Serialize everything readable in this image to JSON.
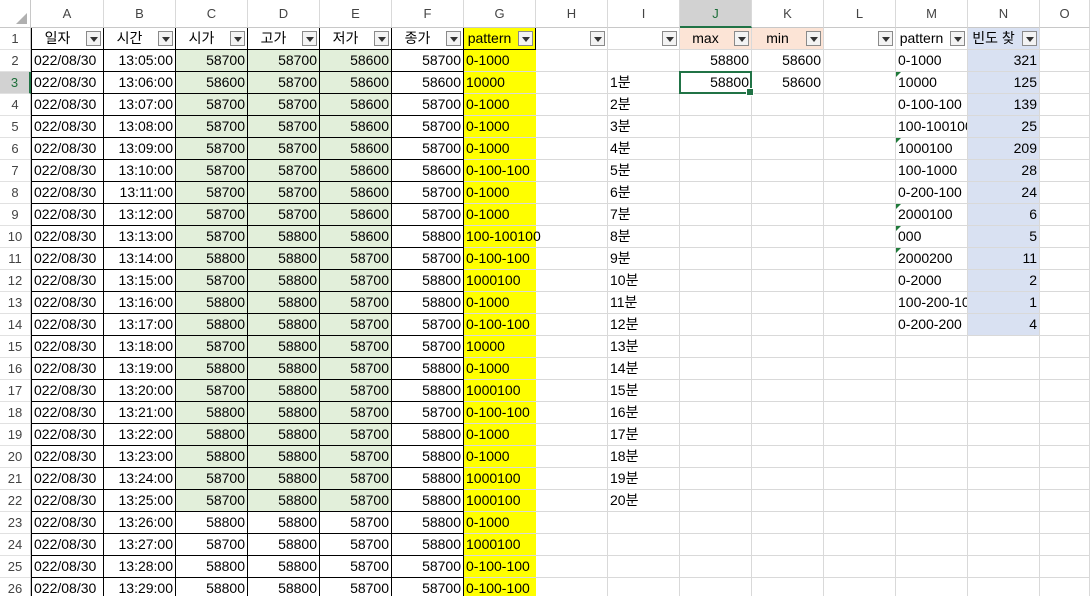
{
  "sheet": {
    "columns": [
      "A",
      "B",
      "C",
      "D",
      "E",
      "F",
      "G",
      "H",
      "I",
      "J",
      "K",
      "L",
      "M",
      "N",
      "O"
    ],
    "selected_column": "J",
    "selected_row": 3,
    "colors": {
      "green_fill": "#e2efda",
      "yellow_fill": "#ffff00",
      "salmon_fill": "#fce4d6",
      "lavender_fill": "#d9e1f2",
      "selection": "#217346"
    },
    "headers": {
      "A": "일자",
      "B": "시간",
      "C": "시가",
      "D": "고가",
      "E": "저가",
      "F": "종가",
      "G": "pattern",
      "H": "",
      "I": "",
      "J": "max",
      "K": "min",
      "L": "",
      "M": "pattern",
      "N": "빈도 찾"
    },
    "data_rows": [
      {
        "row": 2,
        "date": "022/08/30",
        "time": "13:05:00",
        "open": "58700",
        "high": "58700",
        "low": "58600",
        "close": "58700",
        "pattern": "0-1000"
      },
      {
        "row": 3,
        "date": "022/08/30",
        "time": "13:06:00",
        "open": "58600",
        "high": "58700",
        "low": "58600",
        "close": "58600",
        "pattern": "10000"
      },
      {
        "row": 4,
        "date": "022/08/30",
        "time": "13:07:00",
        "open": "58700",
        "high": "58700",
        "low": "58600",
        "close": "58700",
        "pattern": "0-1000"
      },
      {
        "row": 5,
        "date": "022/08/30",
        "time": "13:08:00",
        "open": "58700",
        "high": "58700",
        "low": "58600",
        "close": "58700",
        "pattern": "0-1000"
      },
      {
        "row": 6,
        "date": "022/08/30",
        "time": "13:09:00",
        "open": "58700",
        "high": "58700",
        "low": "58600",
        "close": "58700",
        "pattern": "0-1000"
      },
      {
        "row": 7,
        "date": "022/08/30",
        "time": "13:10:00",
        "open": "58700",
        "high": "58700",
        "low": "58600",
        "close": "58600",
        "pattern": "0-100-100"
      },
      {
        "row": 8,
        "date": "022/08/30",
        "time": "13:11:00",
        "open": "58700",
        "high": "58700",
        "low": "58600",
        "close": "58700",
        "pattern": "0-1000"
      },
      {
        "row": 9,
        "date": "022/08/30",
        "time": "13:12:00",
        "open": "58700",
        "high": "58700",
        "low": "58600",
        "close": "58700",
        "pattern": "0-1000"
      },
      {
        "row": 10,
        "date": "022/08/30",
        "time": "13:13:00",
        "open": "58700",
        "high": "58800",
        "low": "58600",
        "close": "58800",
        "pattern": "100-100100"
      },
      {
        "row": 11,
        "date": "022/08/30",
        "time": "13:14:00",
        "open": "58800",
        "high": "58800",
        "low": "58700",
        "close": "58700",
        "pattern": "0-100-100"
      },
      {
        "row": 12,
        "date": "022/08/30",
        "time": "13:15:00",
        "open": "58700",
        "high": "58800",
        "low": "58700",
        "close": "58800",
        "pattern": "1000100"
      },
      {
        "row": 13,
        "date": "022/08/30",
        "time": "13:16:00",
        "open": "58800",
        "high": "58800",
        "low": "58700",
        "close": "58800",
        "pattern": "0-1000"
      },
      {
        "row": 14,
        "date": "022/08/30",
        "time": "13:17:00",
        "open": "58800",
        "high": "58800",
        "low": "58700",
        "close": "58700",
        "pattern": "0-100-100"
      },
      {
        "row": 15,
        "date": "022/08/30",
        "time": "13:18:00",
        "open": "58700",
        "high": "58800",
        "low": "58700",
        "close": "58700",
        "pattern": "10000"
      },
      {
        "row": 16,
        "date": "022/08/30",
        "time": "13:19:00",
        "open": "58800",
        "high": "58800",
        "low": "58700",
        "close": "58800",
        "pattern": "0-1000"
      },
      {
        "row": 17,
        "date": "022/08/30",
        "time": "13:20:00",
        "open": "58700",
        "high": "58800",
        "low": "58700",
        "close": "58800",
        "pattern": "1000100"
      },
      {
        "row": 18,
        "date": "022/08/30",
        "time": "13:21:00",
        "open": "58800",
        "high": "58800",
        "low": "58700",
        "close": "58700",
        "pattern": "0-100-100"
      },
      {
        "row": 19,
        "date": "022/08/30",
        "time": "13:22:00",
        "open": "58800",
        "high": "58800",
        "low": "58700",
        "close": "58800",
        "pattern": "0-1000"
      },
      {
        "row": 20,
        "date": "022/08/30",
        "time": "13:23:00",
        "open": "58800",
        "high": "58800",
        "low": "58700",
        "close": "58800",
        "pattern": "0-1000"
      },
      {
        "row": 21,
        "date": "022/08/30",
        "time": "13:24:00",
        "open": "58700",
        "high": "58800",
        "low": "58700",
        "close": "58800",
        "pattern": "1000100"
      },
      {
        "row": 22,
        "date": "022/08/30",
        "time": "13:25:00",
        "open": "58700",
        "high": "58800",
        "low": "58700",
        "close": "58800",
        "pattern": "1000100"
      },
      {
        "row": 23,
        "date": "022/08/30",
        "time": "13:26:00",
        "open": "58800",
        "high": "58800",
        "low": "58700",
        "close": "58800",
        "pattern": "0-1000"
      },
      {
        "row": 24,
        "date": "022/08/30",
        "time": "13:27:00",
        "open": "58700",
        "high": "58800",
        "low": "58700",
        "close": "58800",
        "pattern": "1000100"
      },
      {
        "row": 25,
        "date": "022/08/30",
        "time": "13:28:00",
        "open": "58800",
        "high": "58800",
        "low": "58700",
        "close": "58700",
        "pattern": "0-100-100"
      },
      {
        "row": 26,
        "date": "022/08/30",
        "time": "13:29:00",
        "open": "58800",
        "high": "58800",
        "low": "58700",
        "close": "58700",
        "pattern": "0-100-100"
      }
    ],
    "minute_labels": [
      {
        "row": 3,
        "text": "1분"
      },
      {
        "row": 4,
        "text": "2분"
      },
      {
        "row": 5,
        "text": "3분"
      },
      {
        "row": 6,
        "text": "4분"
      },
      {
        "row": 7,
        "text": "5분"
      },
      {
        "row": 8,
        "text": "6분"
      },
      {
        "row": 9,
        "text": "7분"
      },
      {
        "row": 10,
        "text": "8분"
      },
      {
        "row": 11,
        "text": "9분"
      },
      {
        "row": 12,
        "text": "10분"
      },
      {
        "row": 13,
        "text": "11분"
      },
      {
        "row": 14,
        "text": "12분"
      },
      {
        "row": 15,
        "text": "13분"
      },
      {
        "row": 16,
        "text": "14분"
      },
      {
        "row": 17,
        "text": "15분"
      },
      {
        "row": 18,
        "text": "16분"
      },
      {
        "row": 19,
        "text": "17분"
      },
      {
        "row": 20,
        "text": "18분"
      },
      {
        "row": 21,
        "text": "19분"
      },
      {
        "row": 22,
        "text": "20분"
      }
    ],
    "maxmin": [
      {
        "row": 2,
        "max": "58800",
        "min": "58600"
      },
      {
        "row": 3,
        "max": "58800",
        "min": "58600"
      }
    ],
    "frequency": [
      {
        "row": 2,
        "pattern": "0-1000",
        "count": "321",
        "flag": false
      },
      {
        "row": 3,
        "pattern": "10000",
        "count": "125",
        "flag": true
      },
      {
        "row": 4,
        "pattern": "0-100-100",
        "count": "139",
        "flag": false
      },
      {
        "row": 5,
        "pattern": "100-100100",
        "count": "25",
        "flag": false
      },
      {
        "row": 6,
        "pattern": "1000100",
        "count": "209",
        "flag": true
      },
      {
        "row": 7,
        "pattern": "100-1000",
        "count": "28",
        "flag": false
      },
      {
        "row": 8,
        "pattern": "0-200-100",
        "count": "24",
        "flag": false
      },
      {
        "row": 9,
        "pattern": "2000100",
        "count": "6",
        "flag": true
      },
      {
        "row": 10,
        "pattern": "000",
        "count": "5",
        "flag": true
      },
      {
        "row": 11,
        "pattern": "2000200",
        "count": "11",
        "flag": true
      },
      {
        "row": 12,
        "pattern": "0-2000",
        "count": "2",
        "flag": false
      },
      {
        "row": 13,
        "pattern": "100-200-100",
        "count": "1",
        "flag": false
      },
      {
        "row": 14,
        "pattern": "0-200-200",
        "count": "4",
        "flag": false
      }
    ]
  }
}
